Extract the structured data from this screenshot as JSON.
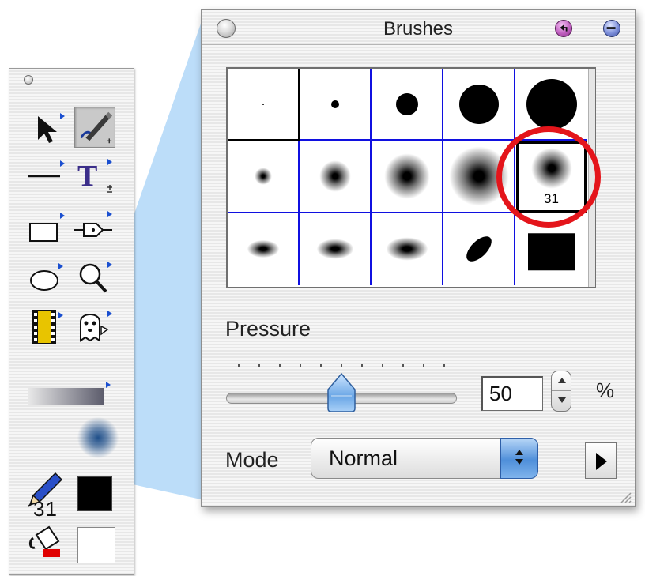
{
  "toolbox": {
    "brush_size_value": "31",
    "tools": [
      {
        "name": "arrow-tool",
        "icon": "arrow-select-icon"
      },
      {
        "name": "brush-tool",
        "icon": "brush-pen-icon",
        "active": true
      },
      {
        "name": "line-tool",
        "icon": "line-icon"
      },
      {
        "name": "text-tool",
        "icon": "text-t-icon"
      },
      {
        "name": "rectangle-tool",
        "icon": "rectangle-icon"
      },
      {
        "name": "pen-tool",
        "icon": "pen-nib-icon"
      },
      {
        "name": "oval-tool",
        "icon": "oval-icon"
      },
      {
        "name": "zoom-tool",
        "icon": "magnifier-icon"
      },
      {
        "name": "movie-tool",
        "icon": "film-strip-icon"
      },
      {
        "name": "ghost-tool",
        "icon": "ghost-icon"
      }
    ],
    "colors": {
      "brush_preview": "#1f4f8a",
      "stroke": "#000000",
      "fill": "#ffffff"
    }
  },
  "palette": {
    "title": "Brushes",
    "selected_brush_label": "31",
    "brushes": [
      {
        "shape": "hard-dot",
        "size": 2
      },
      {
        "shape": "hard-dot",
        "size": 10
      },
      {
        "shape": "hard-dot",
        "size": 28
      },
      {
        "shape": "hard-dot",
        "size": 50
      },
      {
        "shape": "hard-dot",
        "size": 64
      },
      {
        "shape": "soft-dot",
        "size": 22
      },
      {
        "shape": "soft-dot",
        "size": 40
      },
      {
        "shape": "soft-dot",
        "size": 58
      },
      {
        "shape": "soft-dot",
        "size": 76
      },
      {
        "shape": "soft-dot",
        "size": 52,
        "label": "31",
        "selected": true
      },
      {
        "shape": "soft-ellipse",
        "size": 40
      },
      {
        "shape": "soft-ellipse",
        "size": 46
      },
      {
        "shape": "soft-ellipse",
        "size": 52
      },
      {
        "shape": "hard-angled-ellipse",
        "size": 40
      },
      {
        "shape": "hard-square",
        "size": 60
      }
    ],
    "pressure_label": "Pressure",
    "pressure_value": "50",
    "pressure_percent": 50,
    "percent_symbol": "%",
    "mode_label": "Mode",
    "mode_value": "Normal",
    "accent_color": "#1010e0",
    "highlight_color": "#e4151b"
  }
}
